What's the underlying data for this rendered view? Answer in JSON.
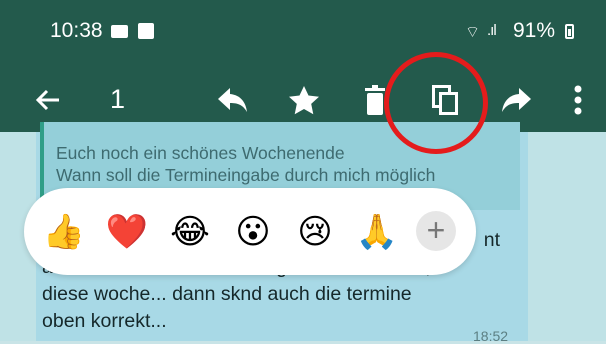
{
  "status_bar": {
    "time": "10:38",
    "battery": "91%"
  },
  "toolbar": {
    "selected_count": "1",
    "icons": [
      "back-arrow-icon",
      "reply-icon",
      "star-icon",
      "delete-icon",
      "copy-icon",
      "forward-icon",
      "more-icon"
    ]
  },
  "message": {
    "quote_line1": "Euch noch ein schönes Wochenende",
    "quote_line2": "Wann soll die Termineingabe durch mich möglich",
    "line1": "nt",
    "line2": "als allerobserstes auf der agenda... ich hoffe,",
    "line3": "diese woche... dann sknd auch die termine",
    "line4": "oben korrekt...",
    "time": "18:52"
  },
  "reactions": {
    "items": [
      "👍",
      "❤️",
      "😂",
      "😮",
      "😢",
      "🙏"
    ],
    "add_label": "+"
  },
  "colors": {
    "header": "#235a4c",
    "chat_bg": "#bfe2e6",
    "highlight": "#e41c1c"
  }
}
